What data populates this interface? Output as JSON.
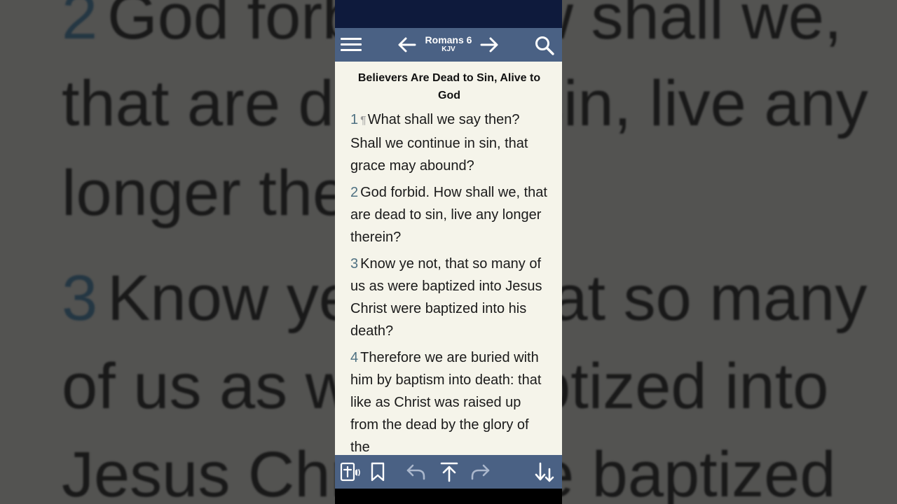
{
  "background": {
    "lines": [
      {
        "num": "2",
        "text": "God forbid. How shall we,"
      },
      {
        "num": "",
        "text": "that are dead to sin, live any"
      },
      {
        "num": "",
        "text": "longer therein?"
      },
      {
        "num": "3",
        "text": "Know ye not, that so many"
      },
      {
        "num": "",
        "text": "of us as were baptized into"
      },
      {
        "num": "",
        "text": "Jesus Christ were baptized"
      }
    ]
  },
  "appbar": {
    "chapter": "Romans 6",
    "version": "KJV"
  },
  "content": {
    "heading": "Believers Are Dead to Sin, Alive to God",
    "pilcrow": "¶",
    "verses": [
      {
        "num": "1",
        "text": "What shall we say then? Shall we continue in sin, that grace may abound?"
      },
      {
        "num": "2",
        "text": "God forbid. How shall we, that are dead to sin, live any longer therein?"
      },
      {
        "num": "3",
        "text": "Know ye not, that so many of us as were baptized into Jesus Christ were baptized into his death?"
      },
      {
        "num": "4",
        "text": "Therefore we are buried with him by baptism into death: that like as Christ was raised up from the dead by the glory of the"
      }
    ]
  },
  "icons": {
    "menu": "hamburger-menu-icon",
    "prev": "arrow-left-icon",
    "next": "arrow-right-icon",
    "search": "search-icon",
    "audio_bible": "bible-audio-icon",
    "bookmark": "bookmark-icon",
    "undo": "undo-icon",
    "scroll_top": "arrow-up-to-top-icon",
    "redo": "redo-icon",
    "sort": "sort-down-icon"
  },
  "colors": {
    "statusbar": "#0e1a3c",
    "appbar": "#4a6184",
    "page": "#f5f4ea",
    "verse_number": "#4f7182"
  }
}
